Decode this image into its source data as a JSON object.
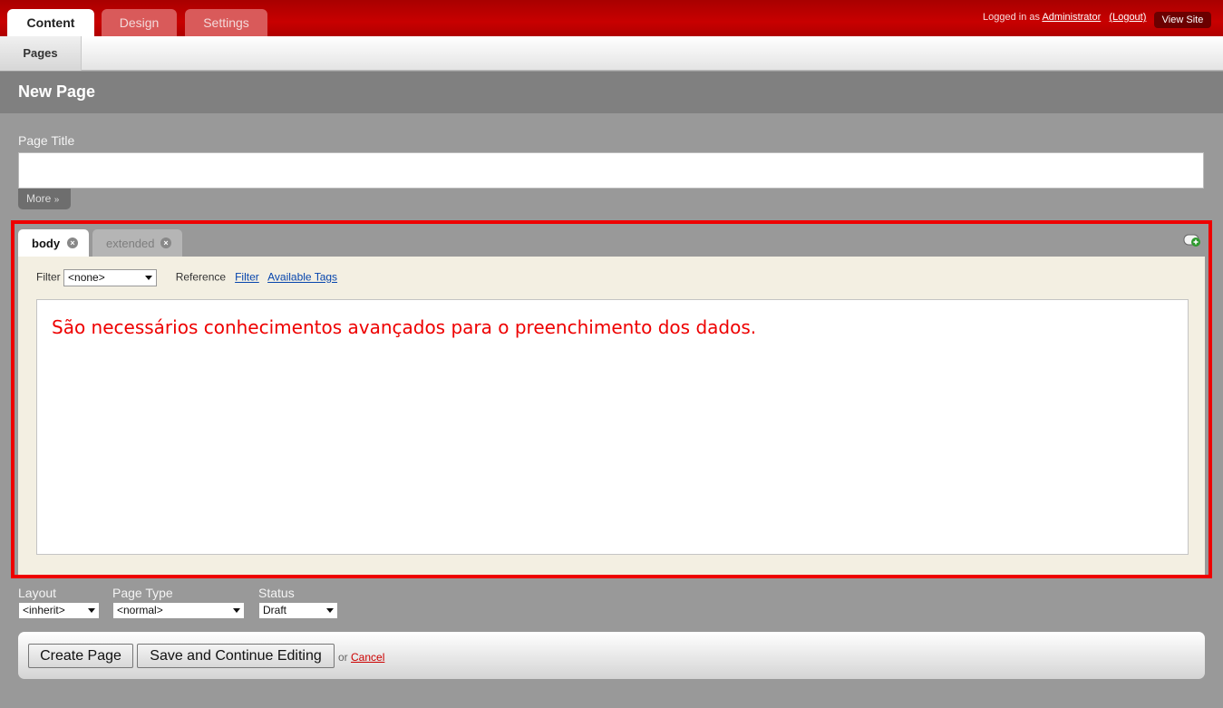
{
  "top_tabs": [
    {
      "label": "Content",
      "active": true
    },
    {
      "label": "Design",
      "active": false
    },
    {
      "label": "Settings",
      "active": false
    }
  ],
  "user": {
    "logged_in_as": "Logged in as",
    "name": "Administrator",
    "logout": "(Logout)",
    "view_site": "View Site"
  },
  "subnav": {
    "pages": "Pages"
  },
  "page_header": {
    "title": "New Page"
  },
  "title_field": {
    "label": "Page Title",
    "value": "",
    "more": "More"
  },
  "editor": {
    "tabs": [
      {
        "label": "body",
        "active": true
      },
      {
        "label": "extended",
        "active": false
      }
    ],
    "filter_label": "Filter",
    "filter_value": "<none>",
    "reference_label": "Reference",
    "reference_filter": "Filter",
    "reference_tags": "Available Tags",
    "content": "São necessários conhecimentos avançados para o preenchimento dos dados."
  },
  "options": {
    "layout_label": "Layout",
    "layout_value": "<inherit>",
    "page_type_label": "Page Type",
    "page_type_value": "<normal>",
    "status_label": "Status",
    "status_value": "Draft"
  },
  "actions": {
    "create": "Create Page",
    "save_continue": "Save and Continue Editing",
    "or": "or",
    "cancel": "Cancel"
  },
  "colors": {
    "header_red": "#c80000",
    "highlight_border": "#ee0000",
    "editor_text": "#ee0000"
  }
}
